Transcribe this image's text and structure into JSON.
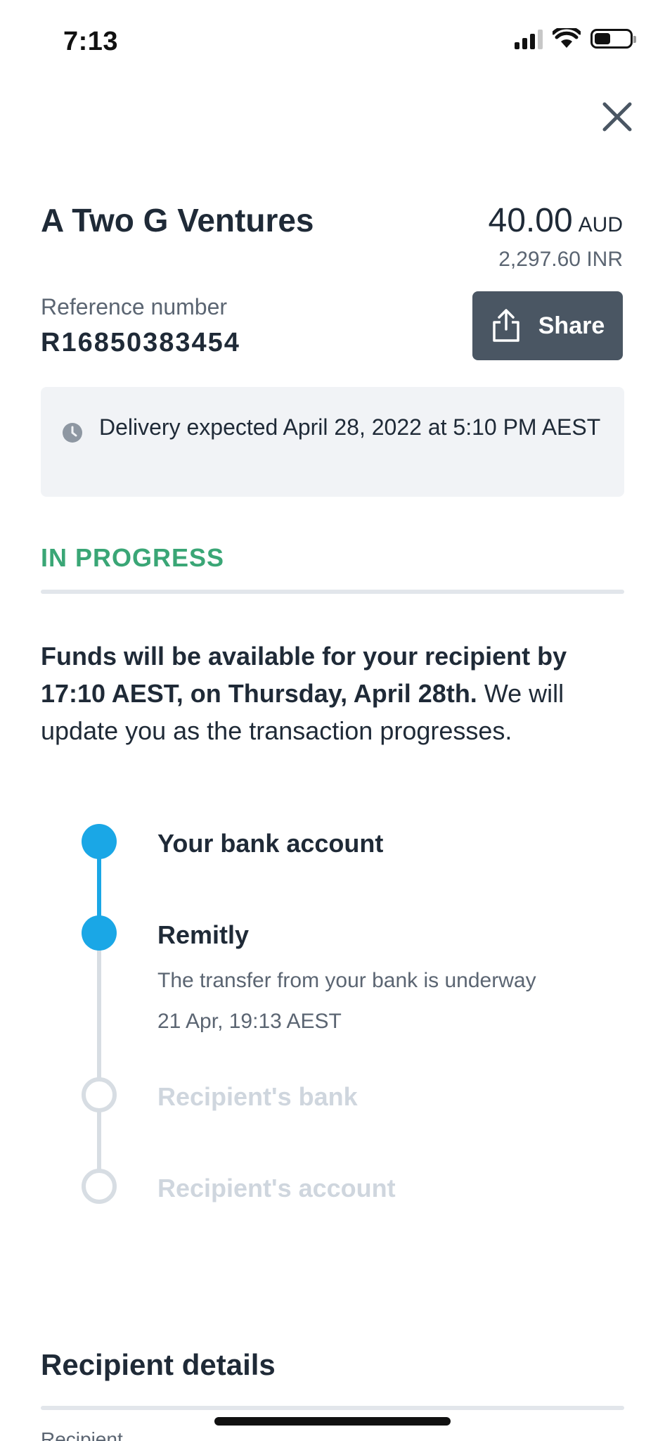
{
  "status_bar": {
    "time": "7:13"
  },
  "header": {
    "close_icon": "close-icon"
  },
  "transfer": {
    "payee": "A Two G Ventures",
    "amount": "40.00",
    "currency": "AUD",
    "converted": "2,297.60 INR",
    "reference_label": "Reference number",
    "reference_number": "R16850383454",
    "share_label": "Share",
    "share_icon": "share-icon"
  },
  "delivery": {
    "icon": "clock-icon",
    "text": "Delivery expected April 28, 2022 at 5:10 PM AEST"
  },
  "status": {
    "label": "IN PROGRESS",
    "color": "#3aa676",
    "message_bold": "Funds will be available for your recipient by 17:10 AEST, on Thursday, April 28th.",
    "message_rest": " We will update you as the transaction progresses."
  },
  "timeline": {
    "accent": "#1aa7e6",
    "steps": [
      {
        "title": "Your bank account",
        "state": "done"
      },
      {
        "title": "Remitly",
        "state": "done",
        "detail": "The transfer from your bank is underway",
        "time": "21 Apr, 19:13 AEST"
      },
      {
        "title": "Recipient's bank",
        "state": "pending"
      },
      {
        "title": "Recipient's account",
        "state": "pending"
      }
    ]
  },
  "recipient_section": {
    "title": "Recipient details",
    "peek_label": "Recipient"
  }
}
